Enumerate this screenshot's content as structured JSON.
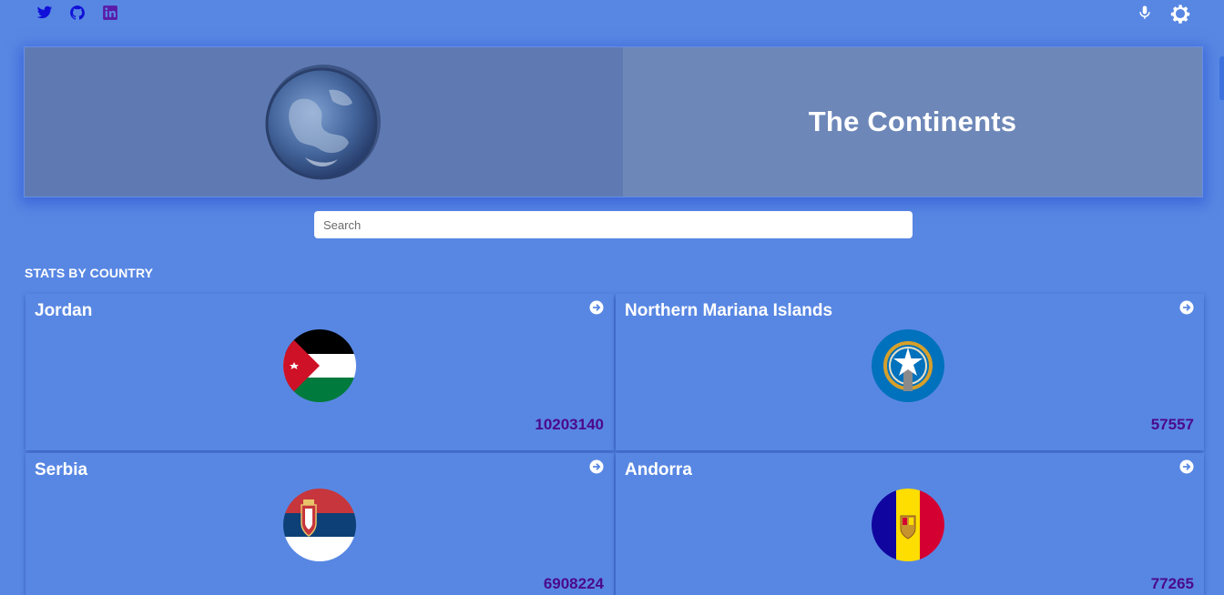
{
  "topbar": {
    "social": [
      {
        "icon": "twitter-icon",
        "color": "#1010d8"
      },
      {
        "icon": "github-icon",
        "color": "#1010d8"
      },
      {
        "icon": "linkedin-icon",
        "color": "#5a1aa8"
      }
    ],
    "actions": [
      {
        "icon": "microphone-icon"
      },
      {
        "icon": "gear-icon"
      }
    ]
  },
  "hero": {
    "title": "The Continents",
    "image": "earth-globe"
  },
  "search": {
    "placeholder": "Search",
    "value": ""
  },
  "section": {
    "title": "STATS BY COUNTRY"
  },
  "countries": [
    {
      "name": "Jordan",
      "population": "10203140",
      "flag": "jordan-flag"
    },
    {
      "name": "Northern Mariana Islands",
      "population": "57557",
      "flag": "northern-mariana-islands-flag"
    },
    {
      "name": "Serbia",
      "population": "6908224",
      "flag": "serbia-flag"
    },
    {
      "name": "Andorra",
      "population": "77265",
      "flag": "andorra-flag"
    }
  ],
  "colors": {
    "background": "#5887e3",
    "population_text": "#4b0a8a",
    "hero_left": "#5f7ab3",
    "hero_right": "#6d87b8"
  }
}
